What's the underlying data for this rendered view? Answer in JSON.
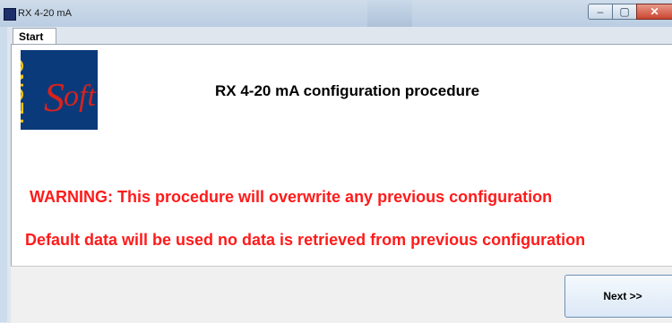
{
  "window": {
    "title": "RX 4-20 mA",
    "icon": "app-icon",
    "controls": {
      "minimize": "minimize-icon",
      "maximize": "maximize-icon",
      "close": "close-icon"
    }
  },
  "tabs": [
    {
      "label": "Start",
      "active": true
    }
  ],
  "logo": {
    "text": "TECNO",
    "script": "Soft",
    "bg": "#0b3a7a",
    "accent": "#d8231e"
  },
  "main": {
    "heading": "RX 4-20 mA configuration procedure",
    "warning": "WARNING: This procedure will overwrite any previous configuration",
    "note": "Default data will be used no data is retrieved from previous configuration"
  },
  "footer": {
    "next_label": "Next >>"
  },
  "colors": {
    "warning": "#ff1a1a",
    "titlebar": "#b9cde2"
  }
}
